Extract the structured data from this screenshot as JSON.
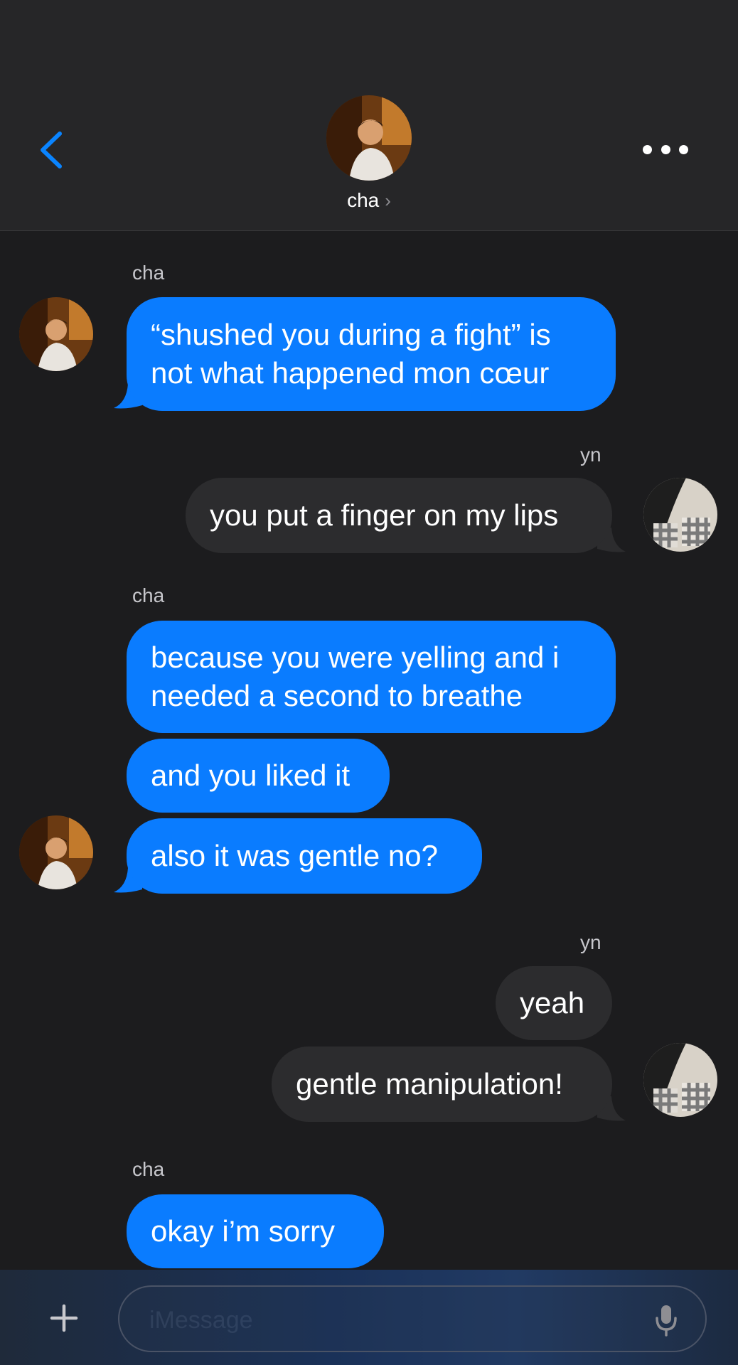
{
  "header": {
    "contact_name": "cha",
    "chevron": "›",
    "back_icon": "chevron-left-icon",
    "more_icon": "ellipsis-icon"
  },
  "input": {
    "placeholder": "iMessage"
  },
  "colors": {
    "incoming_bubble": "#0a7cff",
    "outgoing_bubble": "#2c2c2e",
    "background": "#1c1c1e",
    "accent": "#0a84ff"
  },
  "messages": [
    {
      "sender": "cha",
      "lines": [
        "“shushed you during a fight” is",
        "not what happened mon cœur"
      ]
    },
    {
      "sender": "yn",
      "lines": [
        "you put a finger on my lips"
      ]
    },
    {
      "sender": "cha",
      "lines": [
        "because you were yelling and i",
        "needed a second to breathe"
      ]
    },
    {
      "sender": "cha",
      "lines": [
        "and you liked it"
      ]
    },
    {
      "sender": "cha",
      "lines": [
        "also it was gentle no?"
      ]
    },
    {
      "sender": "yn",
      "lines": [
        "yeah"
      ]
    },
    {
      "sender": "yn",
      "lines": [
        "gentle manipulation!"
      ]
    },
    {
      "sender": "cha",
      "lines": [
        "okay i’m sorry"
      ]
    }
  ]
}
